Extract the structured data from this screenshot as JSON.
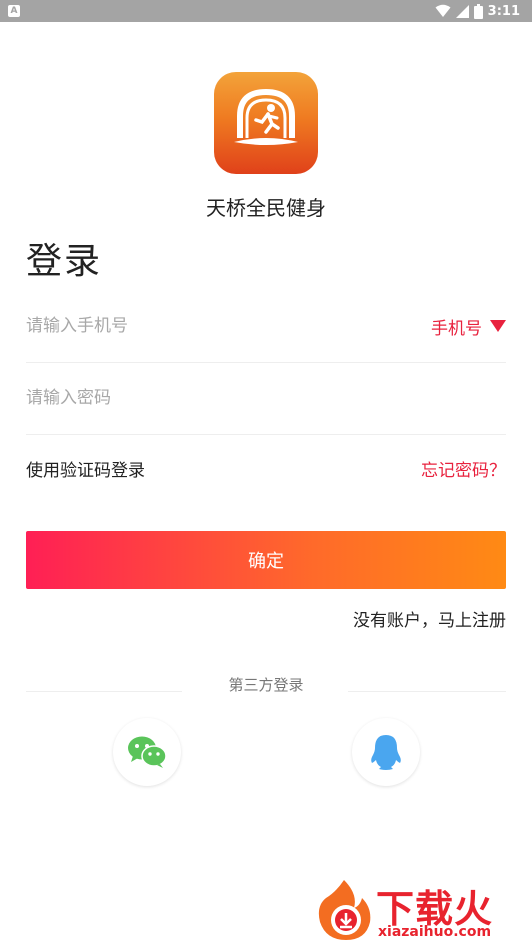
{
  "status_bar": {
    "time": "3:11",
    "left_icon": "A"
  },
  "app": {
    "name": "天桥全民健身",
    "logo_icon": "runner-gate-logo-icon"
  },
  "login": {
    "title": "登录",
    "phone_placeholder": "请输入手机号",
    "phone_type_label": "手机号",
    "password_placeholder": "请输入密码",
    "sms_login_label": "使用验证码登录",
    "forgot_password_label": "忘记密码？",
    "confirm_label": "确定",
    "register_label": "没有账户，马上注册"
  },
  "third_party": {
    "label": "第三方登录",
    "providers": [
      {
        "icon": "wechat-icon"
      },
      {
        "icon": "qq-icon"
      }
    ]
  },
  "watermark": {
    "text": "下载火",
    "url": "xiazaihuo.com"
  },
  "colors": {
    "accent_red": "#e8223e",
    "button_start": "#ff1f55",
    "button_end": "#ff8a14",
    "wechat_green": "#5ac45a",
    "qq_blue": "#4aa6ef"
  }
}
